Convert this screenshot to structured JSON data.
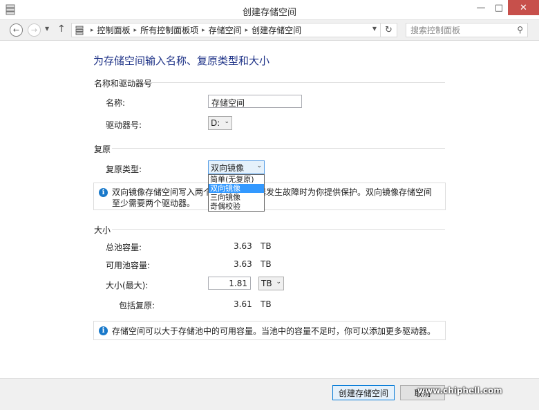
{
  "window": {
    "title": "创建存储空间",
    "minimize": "—",
    "maximize": "□",
    "close": "✕"
  },
  "nav": {
    "breadcrumb": [
      "控制面板",
      "所有控制面板项",
      "存储空间",
      "创建存储空间"
    ],
    "search_placeholder": "搜索控制面板"
  },
  "heading": "为存储空间输入名称、复原类型和大小",
  "name_section": {
    "group_label": "名称和驱动器号",
    "name_label": "名称:",
    "name_value": "存储空间",
    "drive_label": "驱动器号:",
    "drive_value": "D:"
  },
  "resiliency_section": {
    "group_label": "复原",
    "type_label": "复原类型:",
    "type_value": "双向镜像",
    "options": [
      "简单(无复原)",
      "双向镜像",
      "三向镜像",
      "奇偶校验"
    ],
    "selected_index": 1,
    "info_text_line1": "双向镜像存储空间写入两个数",
    "info_text_line1_tail": "个驱动器发生故障时为你提供保护。双向镜像存储空间",
    "info_text_line2": "至少需要两个驱动器。"
  },
  "size_section": {
    "group_label": "大小",
    "total_label": "总池容量:",
    "total_value": "3.63",
    "total_unit": "TB",
    "available_label": "可用池容量:",
    "available_value": "3.63",
    "available_unit": "TB",
    "max_label": "大小(最大):",
    "max_value": "1.81",
    "max_unit": "TB",
    "including_label": "包括复原:",
    "including_value": "3.61",
    "including_unit": "TB",
    "info_text": "存储空间可以大于存储池中的可用容量。当池中的容量不足时，你可以添加更多驱动器。"
  },
  "footer": {
    "create_button": "创建存储空间",
    "cancel_button": "取消"
  },
  "watermark": {
    "logo_text": "chip hell",
    "url": "www.chiphell.com"
  }
}
